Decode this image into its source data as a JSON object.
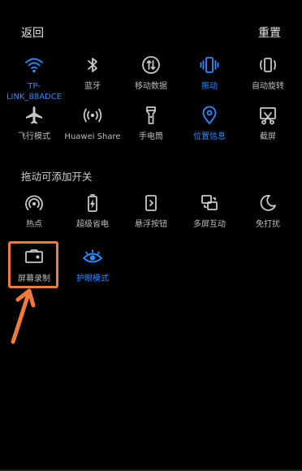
{
  "header": {
    "back": "返回",
    "reset": "重置"
  },
  "section_label": "拖动可添加开关",
  "tiles": [
    {
      "label": "TP-\nLINK_88ADCE",
      "icon": "wifi-icon",
      "active": true
    },
    {
      "label": "蓝牙",
      "icon": "bluetooth-icon",
      "active": false
    },
    {
      "label": "移动数据",
      "icon": "mobile-data-icon",
      "active": false
    },
    {
      "label": "振动",
      "icon": "vibrate-icon",
      "active": true
    },
    {
      "label": "自动旋转",
      "icon": "auto-rotate-icon",
      "active": false
    },
    {
      "label": "飞行模式",
      "icon": "airplane-icon",
      "active": false
    },
    {
      "label": "Huawei Share",
      "icon": "huawei-share-icon",
      "active": false
    },
    {
      "label": "手电筒",
      "icon": "flashlight-icon",
      "active": false
    },
    {
      "label": "位置信息",
      "icon": "location-icon",
      "active": true
    },
    {
      "label": "截屏",
      "icon": "screenshot-icon",
      "active": false
    }
  ],
  "extra_tiles": [
    {
      "label": "热点",
      "icon": "hotspot-icon",
      "active": false
    },
    {
      "label": "超级省电",
      "icon": "battery-saver-icon",
      "active": false
    },
    {
      "label": "悬浮按钮",
      "icon": "floating-button-icon",
      "active": false
    },
    {
      "label": "多屏互动",
      "icon": "multi-screen-icon",
      "active": false
    },
    {
      "label": "免打扰",
      "icon": "do-not-disturb-icon",
      "active": false
    },
    {
      "label": "屏幕录制",
      "icon": "screen-record-icon",
      "active": false
    },
    {
      "label": "护眼模式",
      "icon": "eye-comfort-icon",
      "active": true
    }
  ],
  "colors": {
    "accent": "#2e8bff",
    "highlight": "#f07a3a",
    "background": "#000000"
  }
}
